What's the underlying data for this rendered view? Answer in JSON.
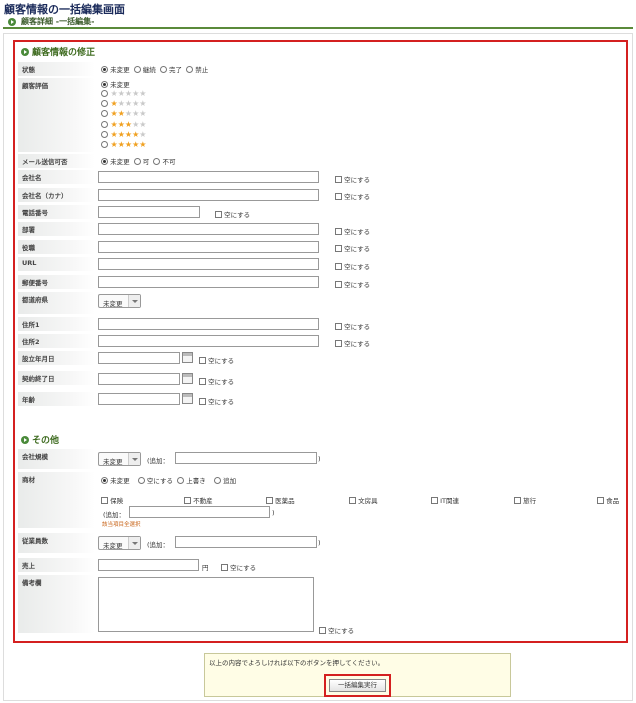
{
  "page_title": "顧客情報の一括編集画面",
  "breadcrumb": "顧客詳細 -一括編集-",
  "section1_title": "顧客情報の修正",
  "section2_title": "その他",
  "labels": {
    "status": "状態",
    "rating": "顧客評価",
    "mail": "メール送信可否",
    "company": "会社名",
    "company_kana": "会社名（カナ）",
    "phone": "電話番号",
    "dept": "部署",
    "position": "役職",
    "url": "URL",
    "zip": "郵便番号",
    "pref": "都道府県",
    "addr1": "住所1",
    "addr2": "住所2",
    "founded": "設立年月日",
    "contract_end": "契約終了日",
    "age": "年齢",
    "company_size": "会社規模",
    "product": "商材",
    "employees": "従業員数",
    "sales": "売上",
    "remarks": "備考欄"
  },
  "status_options": [
    "未変更",
    "継続",
    "完了",
    "禁止"
  ],
  "rating_unchanged": "未変更",
  "mail_options": [
    "未変更",
    "可",
    "不可"
  ],
  "clear_label": "空にする",
  "select_unchanged": "未変更",
  "add_label": "(追加：",
  "close_paren": ")",
  "product_modes": [
    "未変更",
    "空にする",
    "上書き",
    "追加"
  ],
  "product_categories": [
    "保険",
    "不動産",
    "医薬品",
    "文房具",
    "IT関連",
    "旅行",
    "食品"
  ],
  "clear_all_link": "該当項目全選択",
  "yen": "円",
  "note_text": "以上の内容でよろしければ以下のボタンを押してください。",
  "submit_label": "一括編集実行",
  "colors": {
    "accent_green": "#4a8a3a",
    "highlight_red": "#d42020",
    "star": "#f0a020"
  }
}
